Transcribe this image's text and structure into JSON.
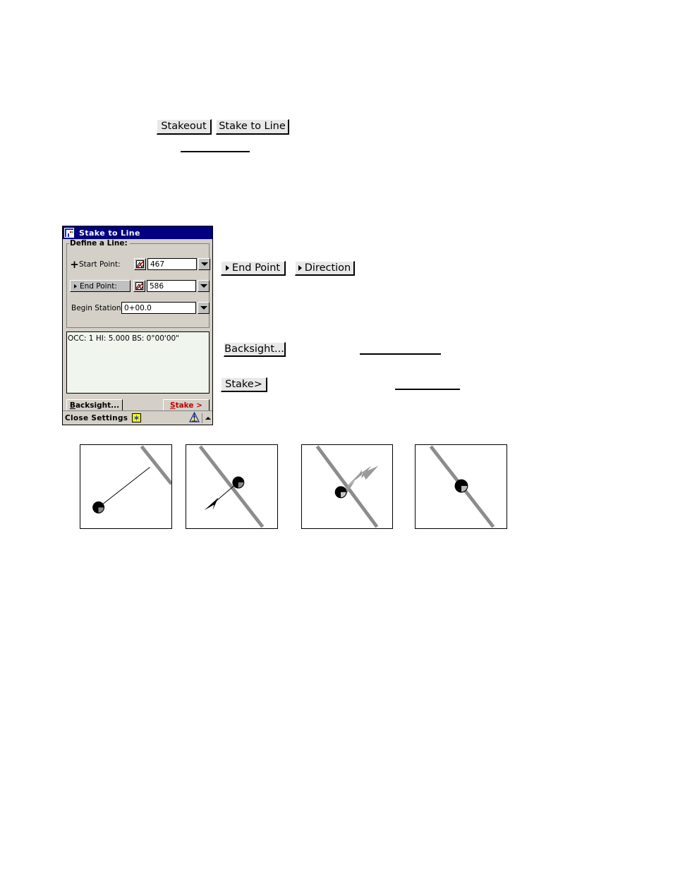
{
  "reference_buttons": {
    "stakeout": "Stakeout",
    "stake_to_line": "Stake to Line",
    "end_point": "End Point",
    "direction": "Direction",
    "backsight": "Backsight...",
    "stake": "Stake>"
  },
  "dialog": {
    "title": "Stake to Line",
    "title_icon": "survey-app-icon",
    "groupbox_legend": "Define a Line:",
    "fields": [
      {
        "icon": "plus-icon",
        "label": "Start Point:",
        "picker_icon": "map-pick-icon",
        "value": "467",
        "dropdown_icon": "chevron-down-icon"
      },
      {
        "icon": "triangle-right-icon",
        "label": "End Point:",
        "picker_icon": "map-pick-icon",
        "value": "586",
        "dropdown_icon": "chevron-down-icon"
      },
      {
        "icon": "",
        "label": "Begin Station:",
        "picker_icon": "",
        "value": "0+00.0",
        "dropdown_icon": "chevron-down-icon"
      }
    ],
    "status_line": "OCC: 1  HI: 5.000  BS: 0°00'00\"",
    "buttons": {
      "backsight_accel": "B",
      "backsight_rest": "acksight...",
      "stake_accel": "S",
      "stake_rest": "take >"
    },
    "taskbar": {
      "label": "Close Settings",
      "star_icon": "blue-star-icon",
      "tray_icon": "instrument-icon",
      "tray_up_icon": "chevron-up-icon"
    }
  },
  "illustrations": [
    {
      "name": "offset-from-line",
      "description": "Target marker at lower left with thin line drawn to a grey line at upper right"
    },
    {
      "name": "arrow-away-from-line",
      "description": "Grey line with target marker and black arrow pointing away down-left"
    },
    {
      "name": "arrow-toward-line",
      "description": "Grey line with target marker on it and grey arrow pointing up-right"
    },
    {
      "name": "on-line",
      "description": "Grey line with target marker centered on the line"
    }
  ],
  "colors": {
    "titlebar": "#000080",
    "dialog_face": "#d4d0c8",
    "list_pane": "#f0f5ee",
    "accent_red": "#c00000",
    "star_yellow": "#ffff00",
    "line_grey": "#8c8c8c"
  }
}
